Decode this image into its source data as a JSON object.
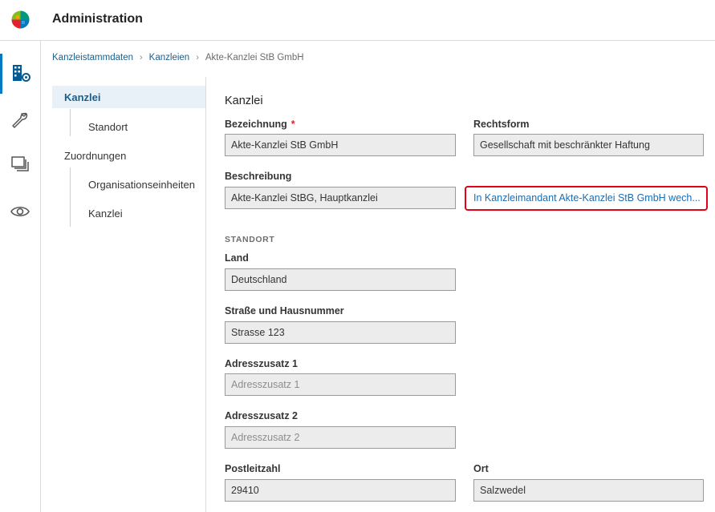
{
  "app": {
    "title": "Administration"
  },
  "breadcrumb": {
    "items": [
      "Kanzleistammdaten",
      "Kanzleien",
      "Akte-Kanzlei StB GmbH"
    ]
  },
  "rail": {
    "icons": [
      "building-settings-icon",
      "wrench-icon",
      "layers-icon",
      "eye-icon"
    ]
  },
  "nav": {
    "kanzlei": "Kanzlei",
    "standort": "Standort",
    "zuordnungen": "Zuordnungen",
    "organisationseinheiten": "Organisationseinheiten",
    "kanzlei_sub": "Kanzlei"
  },
  "form": {
    "title": "Kanzlei",
    "bezeichnung": {
      "label": "Bezeichnung",
      "required": "*",
      "value": "Akte-Kanzlei StB GmbH"
    },
    "rechtsform": {
      "label": "Rechtsform",
      "value": "Gesellschaft mit beschränkter Haftung"
    },
    "beschreibung": {
      "label": "Beschreibung",
      "value": "Akte-Kanzlei StBG, Hauptkanzlei"
    },
    "switch_link": "In Kanzleimandant Akte-Kanzlei StB GmbH wech...",
    "section_standort": "STANDORT",
    "land": {
      "label": "Land",
      "value": "Deutschland"
    },
    "strasse": {
      "label": "Straße und Hausnummer",
      "value": "Strasse 123"
    },
    "adresszusatz1": {
      "label": "Adresszusatz 1",
      "placeholder": "Adresszusatz 1"
    },
    "adresszusatz2": {
      "label": "Adresszusatz 2",
      "placeholder": "Adresszusatz 2"
    },
    "plz": {
      "label": "Postleitzahl",
      "value": "29410"
    },
    "ort": {
      "label": "Ort",
      "value": "Salzwedel"
    }
  },
  "colors": {
    "accent": "#007ac3",
    "link": "#1b5e8c",
    "highlight": "#e2001a"
  }
}
